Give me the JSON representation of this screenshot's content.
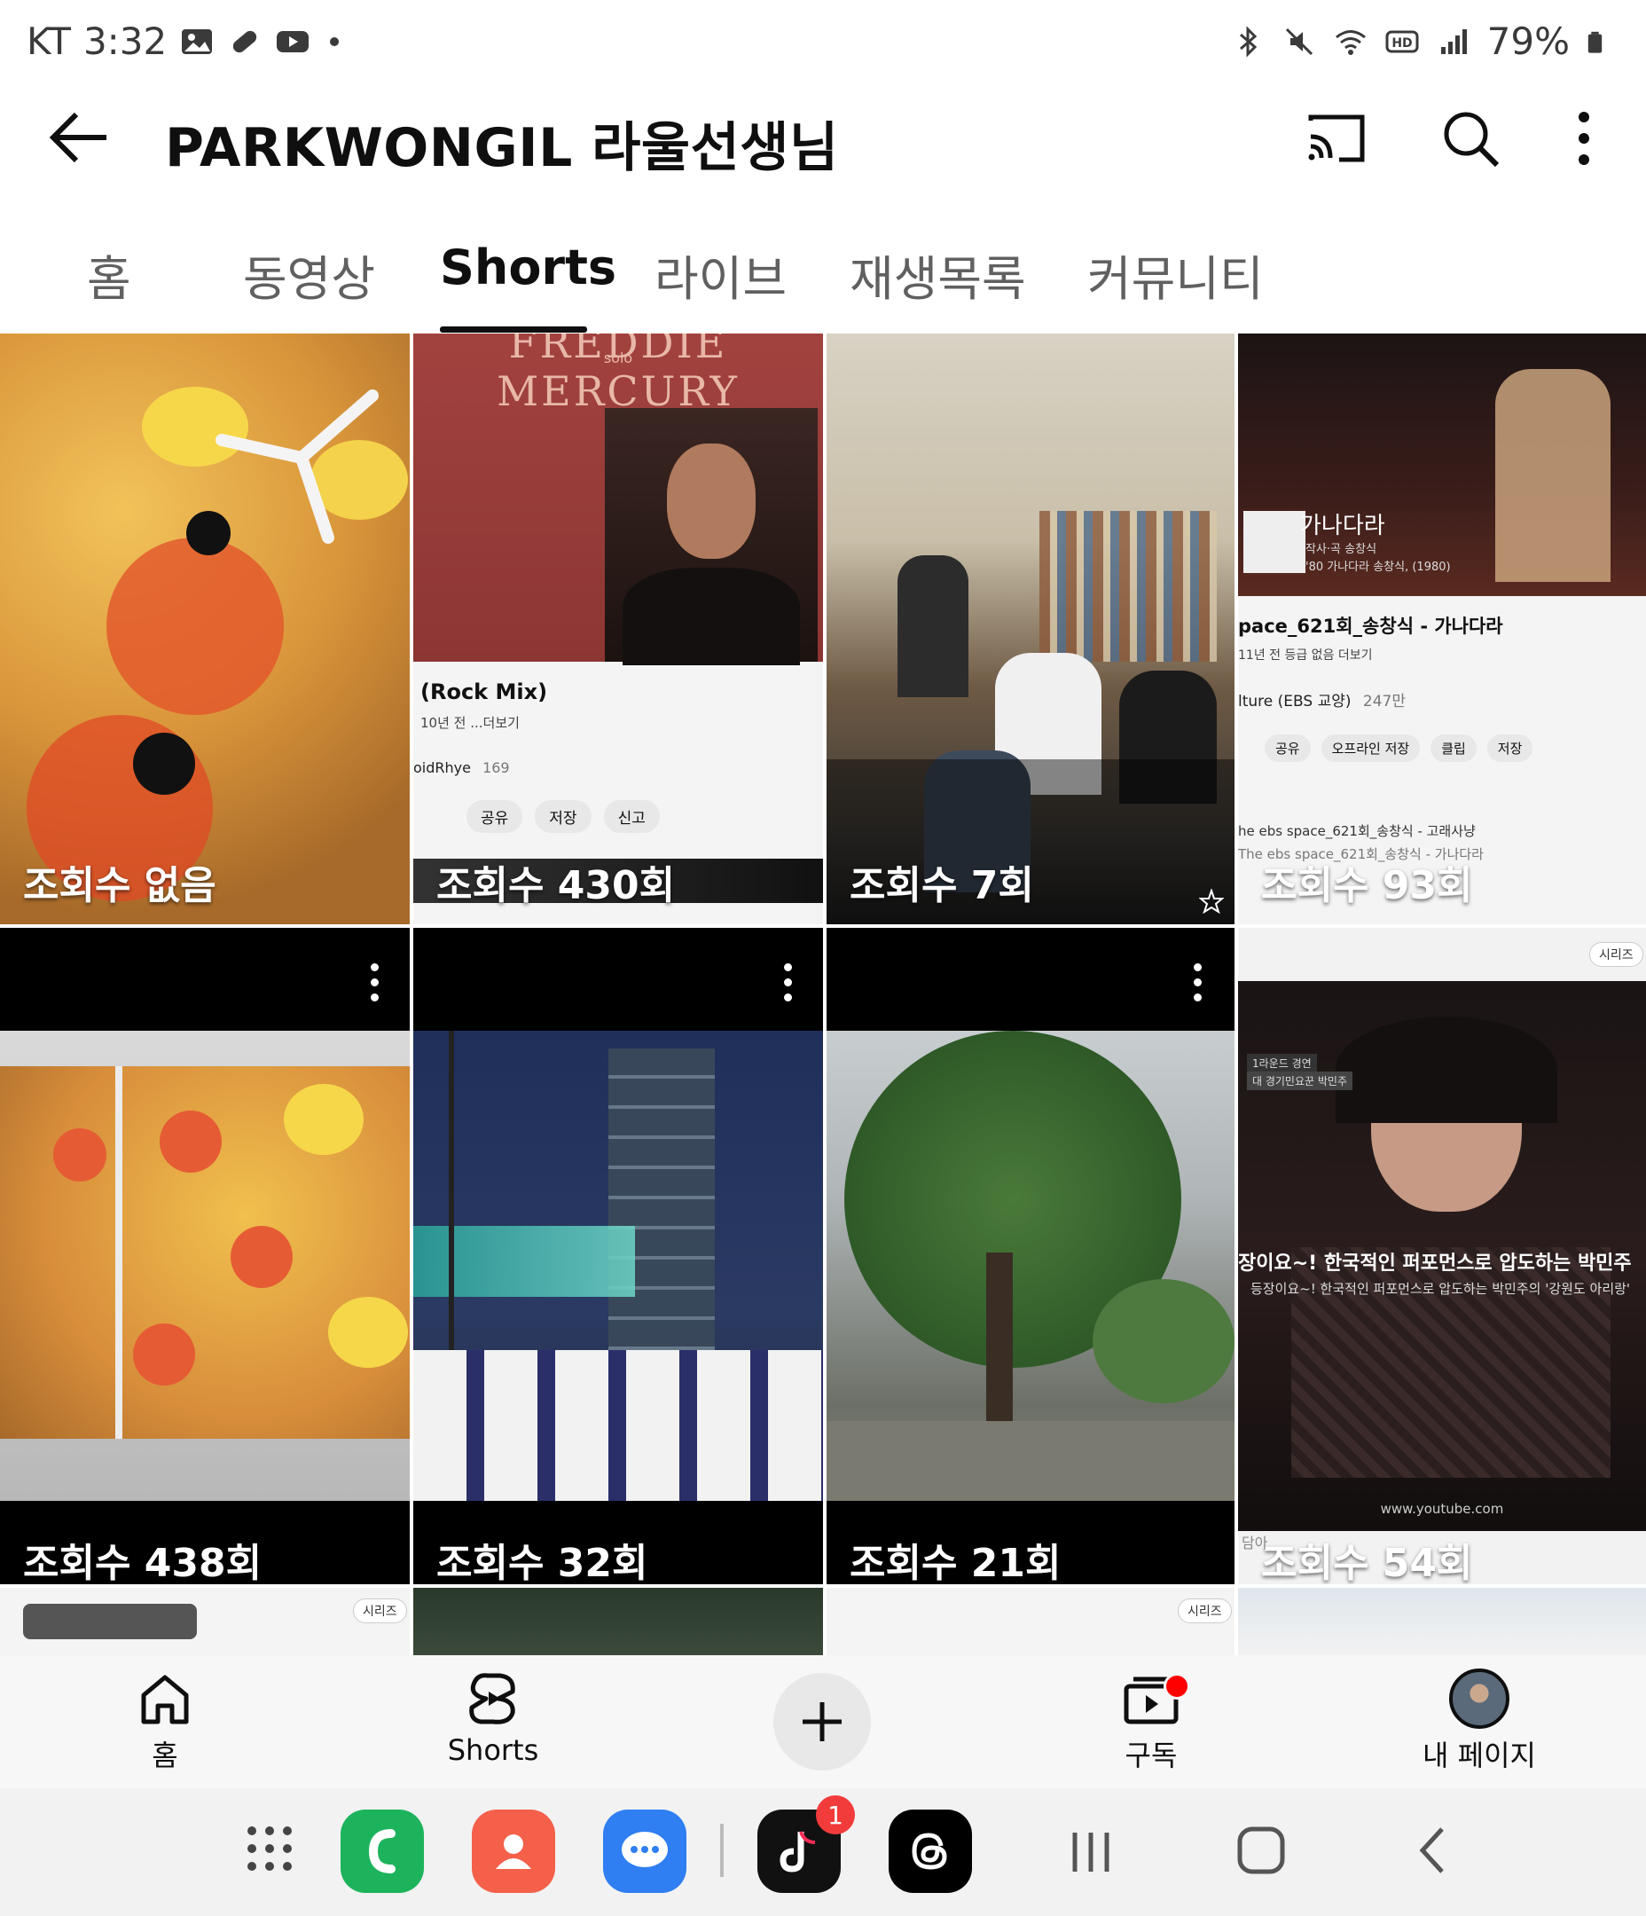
{
  "status_bar": {
    "carrier": "KT",
    "time": "3:32",
    "battery": "79%"
  },
  "header": {
    "title": "PARKWONGIL 라울선생님"
  },
  "tabs": [
    {
      "label": "홈"
    },
    {
      "label": "동영상"
    },
    {
      "label": "Shorts",
      "active": true
    },
    {
      "label": "라이브"
    },
    {
      "label": "재생목록"
    },
    {
      "label": "커뮤니티"
    }
  ],
  "shorts": [
    {
      "views": "조회수 없음"
    },
    {
      "views": "조회수 430회",
      "overlay": {
        "song": "(Rock Mix)",
        "meta": "10년 전  ...더보기",
        "channel": "oidRhye",
        "count": "169",
        "actions": [
          "공유",
          "저장",
          "신고"
        ],
        "header": "FREDDIE MERCURY",
        "sub": "solo"
      }
    },
    {
      "views": "조회수 7회"
    },
    {
      "views": "조회수 93회",
      "overlay": {
        "caption": "가나다라",
        "caption2": "작사·곡 송창식",
        "caption3": "'80 가나다라 송창식, (1980)",
        "title": "pace_621회_송창식 - 가나다라",
        "meta": "11년 전  등급 없음  더보기",
        "channel": "lture (EBS 교양)",
        "count": "247만",
        "actions": [
          "공유",
          "오프라인 저장",
          "클립",
          "저장"
        ],
        "list1": "he ebs space_621회_송창식 - 고래사냥",
        "list2": "The ebs space_621회_송창식 - 가나다라"
      }
    },
    {
      "views": "조회수 438회"
    },
    {
      "views": "조회수 32회"
    },
    {
      "views": "조회수 21회"
    },
    {
      "views": "조회수 54회",
      "overlay": {
        "badge": "시리즈",
        "tag1": "1라운드 경연",
        "tag2": "대 경기민요꾼 박민주",
        "headline": "장이요~! 한국적인 퍼포먼스로 압도하는 박민주",
        "subline": "등장이요~! 한국적인 퍼포먼스로 압도하는 박민주의 '강원도 아리랑'",
        "site": "www.youtube.com",
        "left": "담아"
      }
    }
  ],
  "row3": {
    "badge1": "시리즈",
    "badge2": "시리즈"
  },
  "bottom_nav": [
    {
      "label": "홈",
      "icon": "home-icon"
    },
    {
      "label": "Shorts",
      "icon": "shorts-icon"
    },
    {
      "label": "",
      "icon": "create-plus-icon"
    },
    {
      "label": "구독",
      "icon": "subscriptions-icon"
    },
    {
      "label": "내 페이지",
      "icon": "avatar"
    }
  ],
  "dock": {
    "tiktok_badge": "1"
  },
  "colors": {
    "active_tab": "#0f0f0f",
    "inactive_tab": "#606060",
    "notification_dot": "#ff0000"
  }
}
